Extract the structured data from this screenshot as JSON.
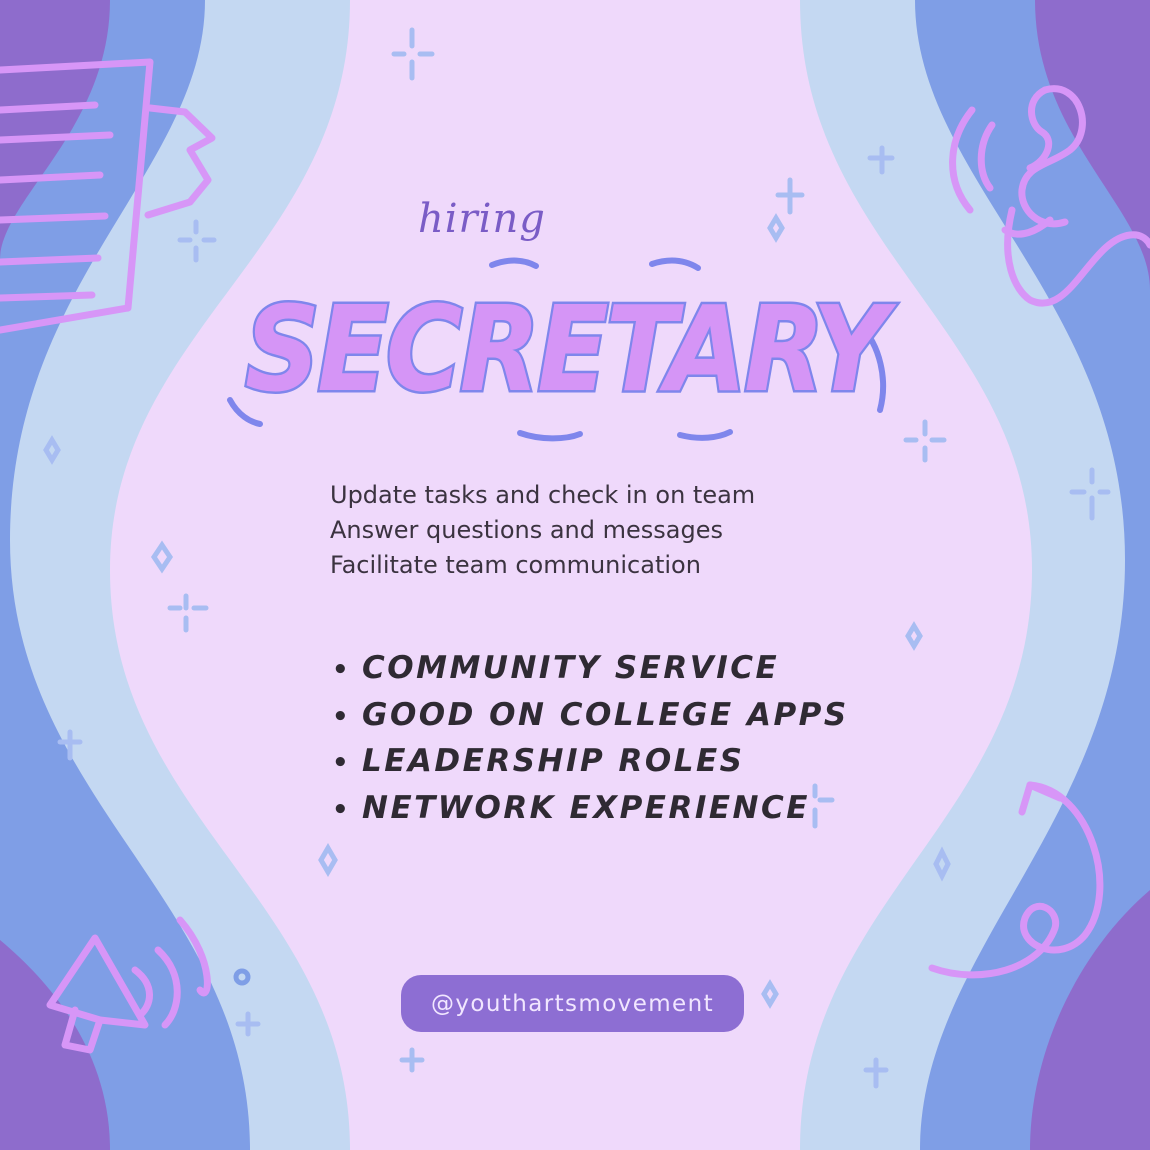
{
  "poster": {
    "kicker": "hiring",
    "title": "SECRETARY",
    "duties": [
      "Update tasks and check in on team",
      "Answer questions and messages",
      "Facilitate team communication"
    ],
    "benefits": [
      "COMMUNITY SERVICE",
      "GOOD ON COLLEGE APPS",
      "LEADERSHIP ROLES",
      "NETWORK EXPERIENCE"
    ],
    "bullet_glyph": "•",
    "handle": "@youthartsmovement"
  },
  "colors": {
    "background_center": "#efd9fb",
    "wave_light": "#c4d8f2",
    "wave_mid": "#7f9ee6",
    "wave_dark": "#8e6ccc",
    "doodle": "#d796f7",
    "title_fill": "#d595f6",
    "title_outline": "#7f86ec",
    "button": "#8d6ed3"
  },
  "icons": [
    "clipboard-icon",
    "phone-icon",
    "megaphone-icon",
    "curly-arrow-icon",
    "sparkle-icon"
  ]
}
